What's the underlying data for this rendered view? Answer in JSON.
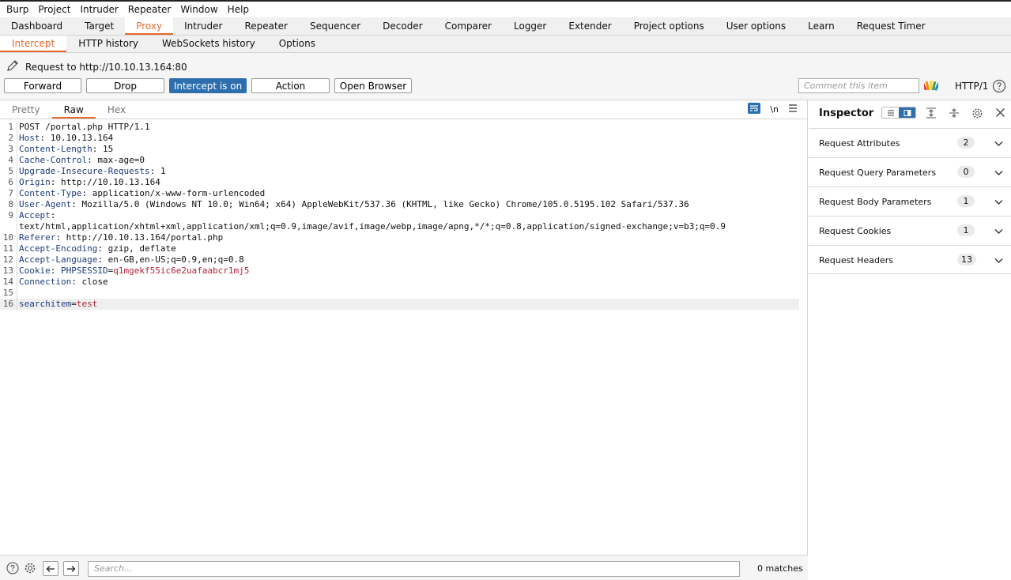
{
  "menu": [
    "Burp",
    "Project",
    "Intruder",
    "Repeater",
    "Window",
    "Help"
  ],
  "main_tabs": [
    "Dashboard",
    "Target",
    "Proxy",
    "Intruder",
    "Repeater",
    "Sequencer",
    "Decoder",
    "Comparer",
    "Logger",
    "Extender",
    "Project options",
    "User options",
    "Learn",
    "Request Timer"
  ],
  "main_active": "Proxy",
  "sub_tabs": [
    "Intercept",
    "HTTP history",
    "WebSockets history",
    "Options"
  ],
  "sub_active": "Intercept",
  "request_info": "Request to http://10.10.13.164:80",
  "buttons": {
    "forward": "Forward",
    "drop": "Drop",
    "intercept": "Intercept is on",
    "action": "Action",
    "open_browser": "Open Browser"
  },
  "comment_placeholder": "Comment this item",
  "http_version": "HTTP/1",
  "editor": {
    "tabs": [
      "Pretty",
      "Raw",
      "Hex"
    ],
    "active_tab": "Raw",
    "newline_toggle": "\\n",
    "lines": [
      {
        "n": "1",
        "name": "",
        "sep": "",
        "val": "POST /portal.php HTTP/1.1"
      },
      {
        "n": "2",
        "name": "Host",
        "sep": ": ",
        "val": "10.10.13.164"
      },
      {
        "n": "3",
        "name": "Content-Length",
        "sep": ": ",
        "val": "15"
      },
      {
        "n": "4",
        "name": "Cache-Control",
        "sep": ": ",
        "val": "max-age=0"
      },
      {
        "n": "5",
        "name": "Upgrade-Insecure-Requests",
        "sep": ": ",
        "val": "1"
      },
      {
        "n": "6",
        "name": "Origin",
        "sep": ": ",
        "val": "http://10.10.13.164"
      },
      {
        "n": "7",
        "name": "Content-Type",
        "sep": ": ",
        "val": "application/x-www-form-urlencoded"
      },
      {
        "n": "8",
        "name": "User-Agent",
        "sep": ": ",
        "val": "Mozilla/5.0 (Windows NT 10.0; Win64; x64) AppleWebKit/537.36 (KHTML, like Gecko) Chrome/105.0.5195.102 Safari/537.36"
      },
      {
        "n": "9",
        "name": "Accept",
        "sep": ":",
        "val": ""
      },
      {
        "n": "",
        "name": "",
        "sep": "",
        "val": "text/html,application/xhtml+xml,application/xml;q=0.9,image/avif,image/webp,image/apng,*/*;q=0.8,application/signed-exchange;v=b3;q=0.9"
      },
      {
        "n": "10",
        "name": "Referer",
        "sep": ": ",
        "val": "http://10.10.13.164/portal.php"
      },
      {
        "n": "11",
        "name": "Accept-Encoding",
        "sep": ": ",
        "val": "gzip, deflate"
      },
      {
        "n": "12",
        "name": "Accept-Language",
        "sep": ": ",
        "val": "en-GB,en-US;q=0.9,en;q=0.8"
      },
      {
        "n": "13",
        "name": "Cookie",
        "sep": ": ",
        "val": "",
        "cookie_name": "PHPSESSID",
        "cookie_eq": "=",
        "cookie_val": "q1mgekf55ic6e2uafaabcr1mj5"
      },
      {
        "n": "14",
        "name": "Connection",
        "sep": ": ",
        "val": "close"
      },
      {
        "n": "15",
        "name": "",
        "sep": "",
        "val": ""
      },
      {
        "n": "16",
        "name": "",
        "sep": "",
        "val": "",
        "param_name": "searchitem",
        "param_eq": "=",
        "param_val": "test",
        "selected": true
      }
    ]
  },
  "search": {
    "placeholder": "Search...",
    "matches": "0 matches"
  },
  "inspector": {
    "title": "Inspector",
    "sections": [
      {
        "label": "Request Attributes",
        "count": "2"
      },
      {
        "label": "Request Query Parameters",
        "count": "0"
      },
      {
        "label": "Request Body Parameters",
        "count": "1"
      },
      {
        "label": "Request Cookies",
        "count": "1"
      },
      {
        "label": "Request Headers",
        "count": "13"
      }
    ]
  },
  "colors": {
    "accent": "#e8692e",
    "primary_button": "#2d6fad",
    "header_name": "#1e3c7a",
    "cookie_value": "#b0243a"
  }
}
